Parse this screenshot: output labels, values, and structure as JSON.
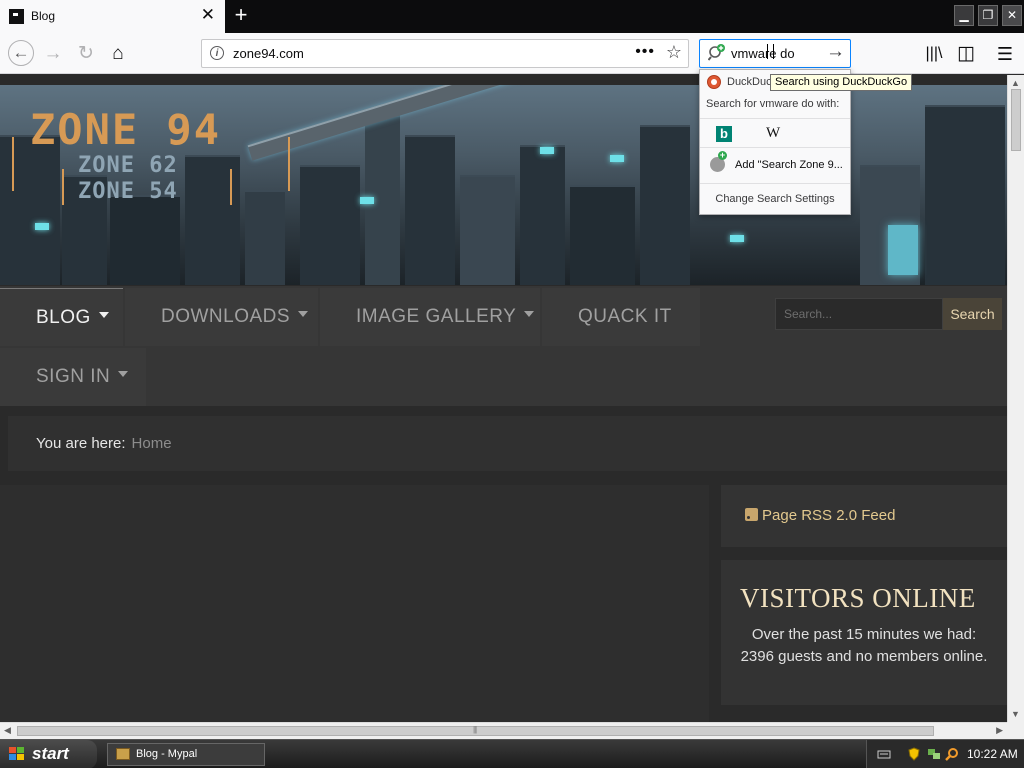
{
  "browser": {
    "tab_title": "Blog",
    "tab_close_glyph": "✕",
    "new_tab_glyph": "+",
    "window_buttons": {
      "minimize": "▁",
      "maximize": "❐",
      "close": "✕"
    },
    "url": "zone94.com",
    "url_more_glyph": "•••",
    "bookmark_glyph": "☆",
    "search_query": "vmware do",
    "icons": {
      "back": "←",
      "forward": "→",
      "reload": "↻",
      "home": "⌂",
      "search_go": "→",
      "library": "|||\\",
      "sidebar": "◫",
      "menu": "☰"
    }
  },
  "search_popup": {
    "engine_name": "DuckDuckGo",
    "engine_text_visible": "DuckDuc",
    "search_with_label": "Search for vmware do with:",
    "engines": [
      {
        "name": "Bing",
        "glyph": "b",
        "color": "#008373"
      },
      {
        "name": "Wikipedia",
        "glyph": "W"
      }
    ],
    "add_engine_label": "Add \"Search Zone 9...",
    "settings_label": "Change Search Settings",
    "tooltip": "Search using DuckDuckGo"
  },
  "site": {
    "logo": {
      "main": "ZONE 94",
      "sub1": "ZONE 62",
      "sub2": "ZONE 54"
    },
    "nav": [
      {
        "label": "BLOG",
        "has_dropdown": true,
        "active": true
      },
      {
        "label": "DOWNLOADS",
        "has_dropdown": true
      },
      {
        "label": "IMAGE GALLERY",
        "has_dropdown": true
      },
      {
        "label": "QUACK IT",
        "has_dropdown": false
      },
      {
        "label": "SIGN IN",
        "has_dropdown": true
      }
    ],
    "search_placeholder": "Search...",
    "search_button": "Search",
    "breadcrumb": {
      "prefix": "You are here:",
      "current": "Home"
    },
    "rss_label": "Page RSS 2.0 Feed",
    "visitors": {
      "title": "VISITORS ONLINE",
      "text": "Over the past 15 minutes we had: 2396 guests and no members online."
    },
    "colors": {
      "accent": "#e3c98f",
      "nav_active": "#f0f0f0",
      "nav_text": "#a0a0a0",
      "background": "#2a2a2a"
    }
  },
  "scrollbars": {
    "up": "▲",
    "down": "▼",
    "left": "◀",
    "right": "▶",
    "grip": "|||"
  },
  "taskbar": {
    "start_label": "start",
    "task_label": "Blog - Mypal",
    "clock": "10:22 AM"
  }
}
